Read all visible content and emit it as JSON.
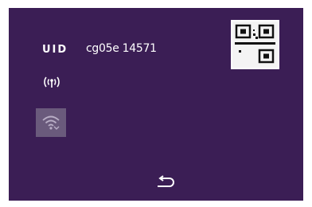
{
  "screen": {
    "uid_label": "UID",
    "uid_value": "cg05e 14571",
    "background_color": "#3b1e55",
    "text_color": "#ffffff"
  },
  "icons": {
    "antenna": "antenna-signal-icon",
    "wifi": "wifi-icon",
    "qr": "qr-code-icon",
    "back": "back-arrow-icon"
  }
}
